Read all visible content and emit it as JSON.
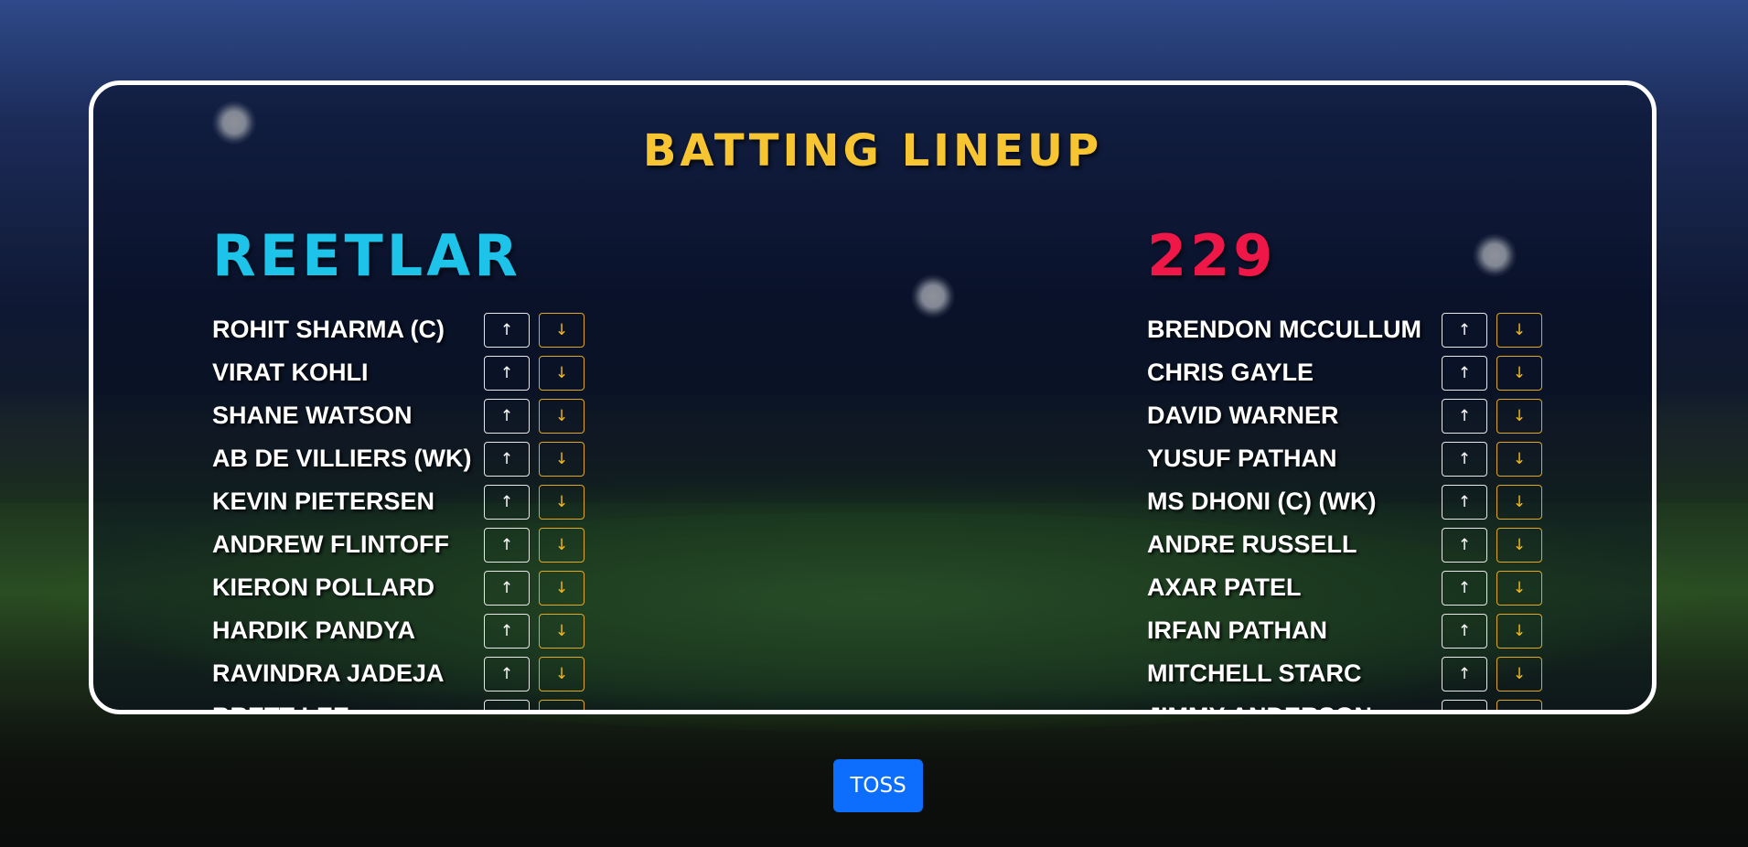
{
  "page_title": "BATTING LINEUP",
  "teams": {
    "left": {
      "name": "REETLAR",
      "color": "#1ec3ea",
      "players": [
        "ROHIT SHARMA (C)",
        "VIRAT KOHLI",
        "SHANE WATSON",
        "AB DE VILLIERS (WK)",
        "KEVIN PIETERSEN",
        "ANDREW FLINTOFF",
        "KIERON POLLARD",
        "HARDIK PANDYA",
        "RAVINDRA JADEJA",
        "BRETT LEE"
      ]
    },
    "right": {
      "name": "229",
      "color": "#ef1747",
      "players": [
        "BRENDON MCCULLUM",
        "CHRIS GAYLE",
        "DAVID WARNER",
        "YUSUF PATHAN",
        "MS DHONI (C) (WK)",
        "ANDRE RUSSELL",
        "AXAR PATEL",
        "IRFAN PATHAN",
        "MITCHELL STARC",
        "JIMMY ANDERSON"
      ]
    }
  },
  "buttons": {
    "move_up_icon": "↑",
    "move_down_icon": "↓",
    "toss_label": "TOSS"
  },
  "colors": {
    "heading": "#f7c531",
    "toss_button": "#0d6efd",
    "down_button": "#f2b81c"
  }
}
